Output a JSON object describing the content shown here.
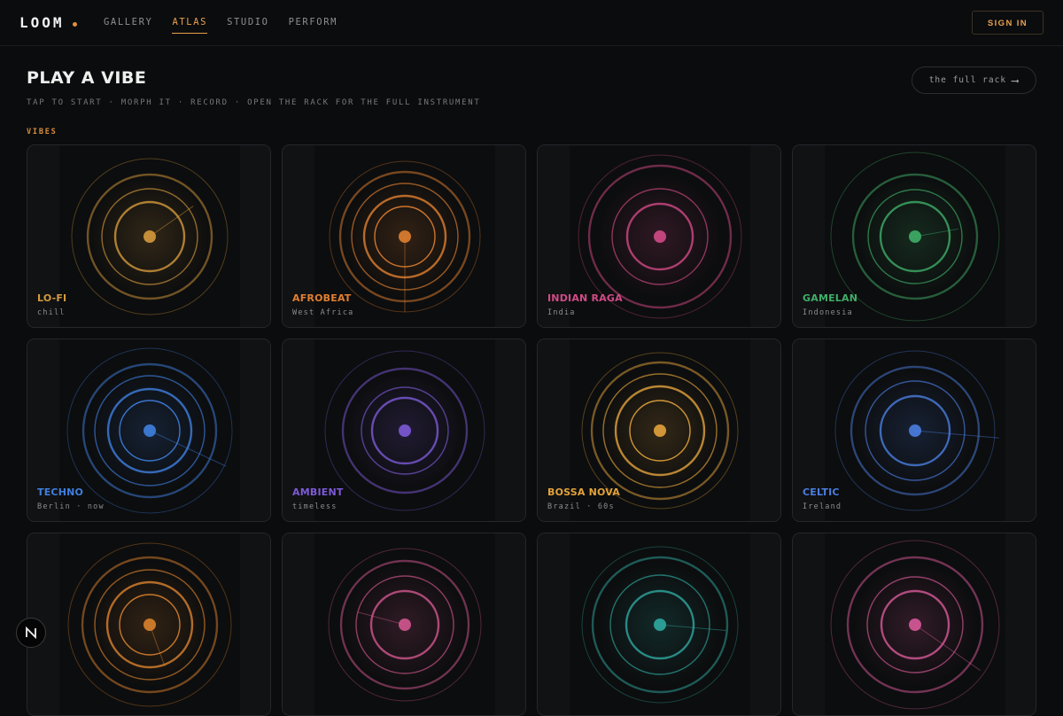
{
  "header": {
    "logo": "LOOM",
    "nav": [
      {
        "label": "GALLERY",
        "active": false
      },
      {
        "label": "ATLAS",
        "active": true
      },
      {
        "label": "STUDIO",
        "active": false
      },
      {
        "label": "PERFORM",
        "active": false
      }
    ],
    "sign_in": "SIGN IN"
  },
  "page": {
    "title": "PLAY A VIBE",
    "subtitle": "TAP TO START · MORPH IT · RECORD · OPEN THE RACK FOR THE FULL INSTRUMENT",
    "rack_button": "the full rack",
    "rack_arrow_icon": "arrow-right-icon",
    "section_label": "VIBES"
  },
  "colors": {
    "accent": "#e8a04d",
    "background": "#0b0c0d"
  },
  "vibes": [
    {
      "name": "LO-FI",
      "sub": "chill",
      "color": "#d59a3c"
    },
    {
      "name": "AFROBEAT",
      "sub": "West Africa",
      "color": "#e07f30"
    },
    {
      "name": "INDIAN RAGA",
      "sub": "India",
      "color": "#d14a86"
    },
    {
      "name": "GAMELAN",
      "sub": "Indonesia",
      "color": "#3fae68"
    },
    {
      "name": "TECHNO",
      "sub": "Berlin · now",
      "color": "#3f7fe0"
    },
    {
      "name": "AMBIENT",
      "sub": "timeless",
      "color": "#7c5ad6"
    },
    {
      "name": "BOSSA NOVA",
      "sub": "Brazil · 60s",
      "color": "#e3a33c"
    },
    {
      "name": "CELTIC",
      "sub": "Ireland",
      "color": "#4a7ee0"
    },
    {
      "name": "",
      "sub": "",
      "color": "#d9822e"
    },
    {
      "name": "",
      "sub": "",
      "color": "#d2588f"
    },
    {
      "name": "",
      "sub": "",
      "color": "#2fa8a0"
    },
    {
      "name": "",
      "sub": "",
      "color": "#d85a9a"
    }
  ],
  "floating_badge": {
    "icon": "n-logo-icon"
  }
}
